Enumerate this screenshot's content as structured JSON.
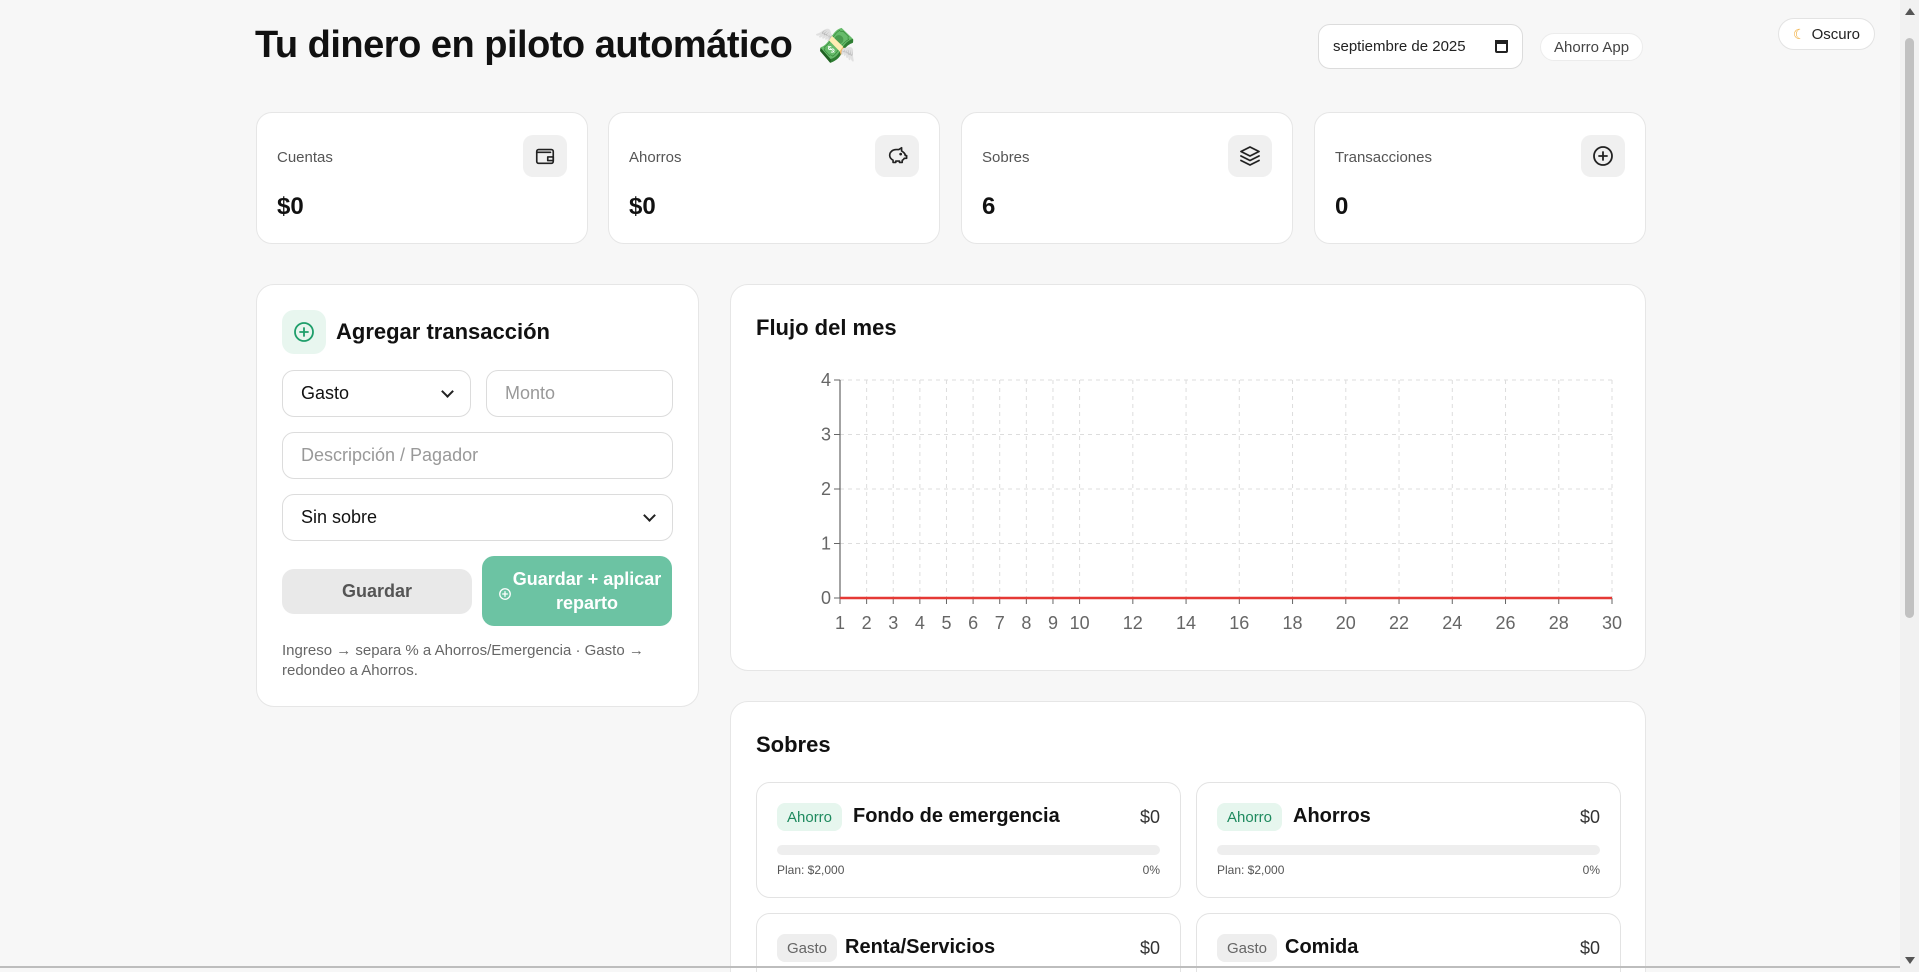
{
  "header": {
    "title": "Tu dinero en piloto automático",
    "emoji": "💸",
    "date_value": "septiembre de 2025",
    "app_name": "Ahorro App",
    "theme_label": "Oscuro"
  },
  "stats": [
    {
      "label": "Cuentas",
      "value": "$0",
      "icon": "wallet-icon"
    },
    {
      "label": "Ahorros",
      "value": "$0",
      "icon": "piggy-bank-icon"
    },
    {
      "label": "Sobres",
      "value": "6",
      "icon": "layers-icon"
    },
    {
      "label": "Transacciones",
      "value": "0",
      "icon": "plus-circle-icon"
    }
  ],
  "form": {
    "title": "Agregar transacción",
    "type_value": "Gasto",
    "amount_placeholder": "Monto",
    "description_placeholder": "Descripción / Pagador",
    "envelope_value": "Sin sobre",
    "save_label": "Guardar",
    "apply_label": "Guardar + aplicar reparto",
    "note": "Ingreso → separa % a Ahorros/Emergencia · Gasto → redondeo a Ahorros."
  },
  "chart": {
    "title": "Flujo del mes"
  },
  "chart_data": {
    "type": "line",
    "title": "Flujo del mes",
    "xlabel": "",
    "ylabel": "",
    "x": [
      1,
      2,
      3,
      4,
      5,
      6,
      7,
      8,
      9,
      10,
      11,
      12,
      13,
      14,
      15,
      16,
      17,
      18,
      19,
      20,
      21,
      22,
      23,
      24,
      25,
      26,
      27,
      28,
      29,
      30
    ],
    "x_tick_labels": [
      "1",
      "2",
      "3",
      "4",
      "5",
      "6",
      "7",
      "8",
      "9",
      "10",
      "12",
      "14",
      "16",
      "18",
      "20",
      "22",
      "24",
      "26",
      "28",
      "30"
    ],
    "y_tick_labels": [
      "0",
      "1",
      "2",
      "3",
      "4"
    ],
    "ylim": [
      0,
      4
    ],
    "xlim": [
      1,
      30
    ],
    "grid": true,
    "series": [
      {
        "values": [
          0,
          0,
          0,
          0,
          0,
          0,
          0,
          0,
          0,
          0,
          0,
          0,
          0,
          0,
          0,
          0,
          0,
          0,
          0,
          0,
          0,
          0,
          0,
          0,
          0,
          0,
          0,
          0,
          0,
          0
        ],
        "color": "#e53935"
      }
    ]
  },
  "sobres": {
    "title": "Sobres",
    "items": [
      {
        "tag": "Ahorro",
        "kind": "ahorro",
        "name": "Fondo de emergencia",
        "amount": "$0",
        "plan": "Plan: $2,000",
        "pct": "0%",
        "progress": 0
      },
      {
        "tag": "Ahorro",
        "kind": "ahorro",
        "name": "Ahorros",
        "amount": "$0",
        "plan": "Plan: $2,000",
        "pct": "0%",
        "progress": 0
      },
      {
        "tag": "Gasto",
        "kind": "gasto",
        "name": "Renta/Servicios",
        "amount": "$0"
      },
      {
        "tag": "Gasto",
        "kind": "gasto",
        "name": "Comida",
        "amount": "$0"
      }
    ]
  },
  "colors": {
    "accent": "#6cc3a3",
    "accent_dark": "#1e8a5e",
    "chart_line": "#e53935"
  }
}
